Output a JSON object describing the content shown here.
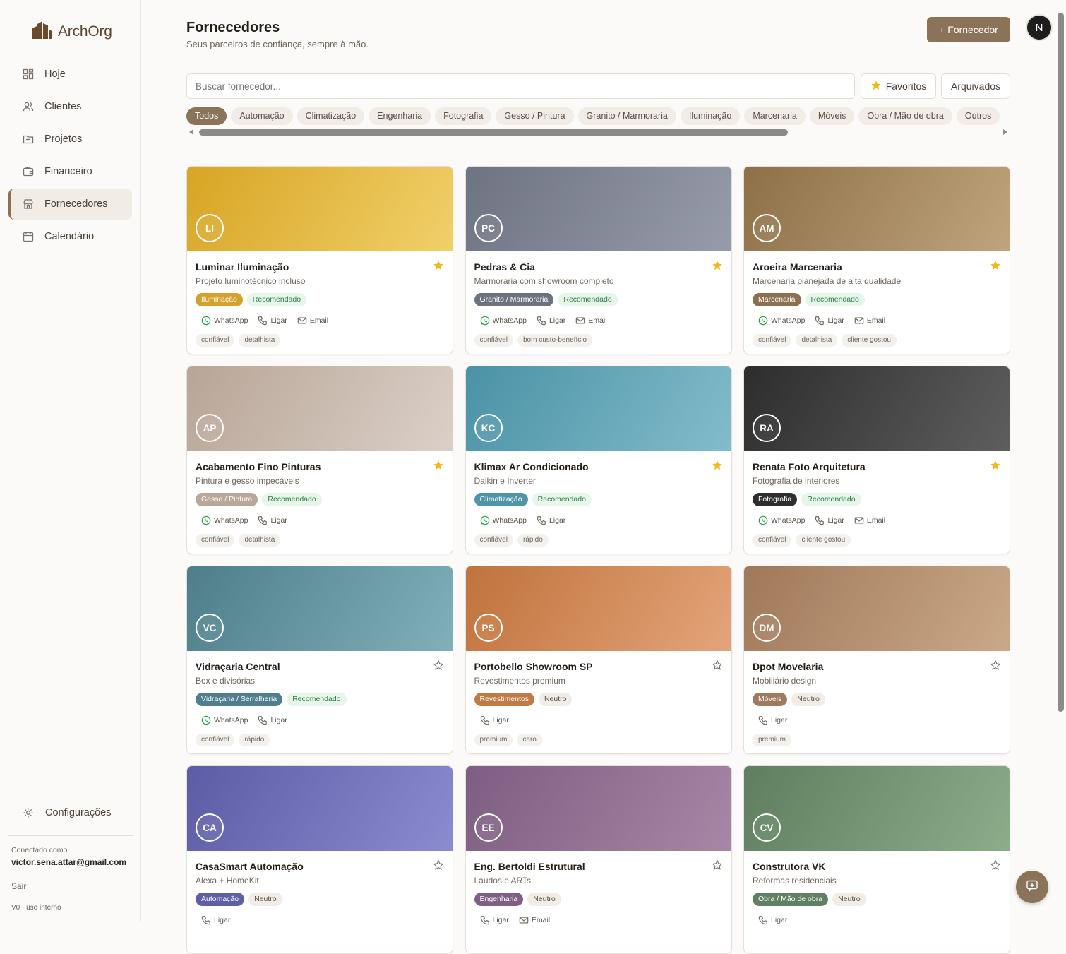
{
  "app": {
    "name": "ArchOrg"
  },
  "sidebar": {
    "items": [
      {
        "label": "Hoje",
        "icon": "dashboard-icon"
      },
      {
        "label": "Clientes",
        "icon": "users-icon"
      },
      {
        "label": "Projetos",
        "icon": "folder-icon"
      },
      {
        "label": "Financeiro",
        "icon": "wallet-icon"
      },
      {
        "label": "Fornecedores",
        "icon": "store-icon",
        "active": true
      },
      {
        "label": "Calendário",
        "icon": "calendar-icon"
      }
    ],
    "settings": "Configurações",
    "connected_as": "Conectado como",
    "email": "victor.sena.attar@gmail.com",
    "logout": "Sair",
    "version": "V0 · uso interno"
  },
  "header": {
    "title": "Fornecedores",
    "subtitle": "Seus parceiros de confiança, sempre à mão.",
    "add_button": "+ Fornecedor",
    "user_initial": "N"
  },
  "search": {
    "placeholder": "Buscar fornecedor..."
  },
  "filters": {
    "favorites": "Favoritos",
    "archived": "Arquivados"
  },
  "categories": [
    "Todos",
    "Automação",
    "Climatização",
    "Engenharia",
    "Fotografia",
    "Gesso / Pintura",
    "Granito / Marmoraria",
    "Iluminação",
    "Marcenaria",
    "Móveis",
    "Obra / Mão de obra",
    "Outros"
  ],
  "labels": {
    "whatsapp": "WhatsApp",
    "call": "Ligar",
    "email": "Email"
  },
  "suppliers": [
    {
      "initials": "LI",
      "name": "Luminar Iluminação",
      "desc": "Projeto luminotécnico incluso",
      "category": "Iluminação",
      "cat_color": "#d4a12a",
      "status": "Recomendado",
      "fav": true,
      "contacts": [
        "whatsapp",
        "call",
        "email"
      ],
      "notes": [
        "confiável",
        "detalhista"
      ],
      "grad": [
        "#d7a524",
        "#f1d06a"
      ]
    },
    {
      "initials": "PC",
      "name": "Pedras & Cia",
      "desc": "Marmoraria com showroom completo",
      "category": "Granito / Marmoraria",
      "cat_color": "#6c7280",
      "status": "Recomendado",
      "fav": true,
      "contacts": [
        "whatsapp",
        "call",
        "email"
      ],
      "notes": [
        "confiável",
        "bom custo-benefício"
      ],
      "grad": [
        "#6e7382",
        "#979caa"
      ]
    },
    {
      "initials": "AM",
      "name": "Aroeira Marcenaria",
      "desc": "Marcenaria planejada de alta qualidade",
      "category": "Marcenaria",
      "cat_color": "#8c7050",
      "status": "Recomendado",
      "fav": true,
      "contacts": [
        "whatsapp",
        "call",
        "email"
      ],
      "notes": [
        "confiável",
        "detalhista",
        "cliente gostou"
      ],
      "grad": [
        "#8d7048",
        "#c0a47c"
      ]
    },
    {
      "initials": "AP",
      "name": "Acabamento Fino Pinturas",
      "desc": "Pintura e gesso impecáveis",
      "category": "Gesso / Pintura",
      "cat_color": "#b9a899",
      "status": "Recomendado",
      "fav": true,
      "contacts": [
        "whatsapp",
        "call"
      ],
      "notes": [
        "confiável",
        "detalhista"
      ],
      "grad": [
        "#b8a596",
        "#dbd0c8"
      ]
    },
    {
      "initials": "KC",
      "name": "Klimax Ar Condicionado",
      "desc": "Daikin e Inverter",
      "category": "Climatização",
      "cat_color": "#4f95a8",
      "status": "Recomendado",
      "fav": true,
      "contacts": [
        "whatsapp",
        "call"
      ],
      "notes": [
        "confiável",
        "rápido"
      ],
      "grad": [
        "#4b92a6",
        "#82bccb"
      ]
    },
    {
      "initials": "RA",
      "name": "Renata Foto Arquitetura",
      "desc": "Fotografia de interiores",
      "category": "Fotografia",
      "cat_color": "#2e2e2e",
      "status": "Recomendado",
      "fav": true,
      "contacts": [
        "whatsapp",
        "call",
        "email"
      ],
      "notes": [
        "confiável",
        "cliente gostou"
      ],
      "grad": [
        "#2d2d2d",
        "#5e5e5e"
      ]
    },
    {
      "initials": "VC",
      "name": "Vidraçaria Central",
      "desc": "Box e divisórias",
      "category": "Vidraçaria / Serralheria",
      "cat_color": "#4f7f8c",
      "status": "Recomendado",
      "fav": false,
      "contacts": [
        "whatsapp",
        "call"
      ],
      "notes": [
        "confiável",
        "rápido"
      ],
      "grad": [
        "#4d7e8a",
        "#80b0ba"
      ]
    },
    {
      "initials": "PS",
      "name": "Portobello Showroom SP",
      "desc": "Revestimentos premium",
      "category": "Revestimentos",
      "cat_color": "#c07a45",
      "status": "Neutro",
      "fav": false,
      "contacts": [
        "call"
      ],
      "notes": [
        "premium",
        "caro"
      ],
      "grad": [
        "#c0733c",
        "#e4a47a"
      ]
    },
    {
      "initials": "DM",
      "name": "Dpot Movelaria",
      "desc": "Mobiliário design",
      "category": "Móveis",
      "cat_color": "#9f7a5e",
      "status": "Neutro",
      "fav": false,
      "contacts": [
        "call"
      ],
      "notes": [
        "premium"
      ],
      "grad": [
        "#a0785a",
        "#caa988"
      ]
    },
    {
      "initials": "CA",
      "name": "CasaSmart Automação",
      "desc": "Alexa + HomeKit",
      "category": "Automação",
      "cat_color": "#5f5fa8",
      "status": "Neutro",
      "fav": false,
      "contacts": [
        "call"
      ],
      "notes": [],
      "grad": [
        "#5c5ca6",
        "#8b8bd0"
      ]
    },
    {
      "initials": "EE",
      "name": "Eng. Bertoldi Estrutural",
      "desc": "Laudos e ARTs",
      "category": "Engenharia",
      "cat_color": "#7f5f84",
      "status": "Neutro",
      "fav": false,
      "contacts": [
        "call",
        "email"
      ],
      "notes": [],
      "grad": [
        "#7d5d82",
        "#a886a6"
      ]
    },
    {
      "initials": "CV",
      "name": "Construtora VK",
      "desc": "Reformas residenciais",
      "category": "Obra / Mão de obra",
      "cat_color": "#5f8062",
      "status": "Neutro",
      "fav": false,
      "contacts": [
        "call"
      ],
      "notes": [],
      "grad": [
        "#5e7e5f",
        "#8cac8a"
      ]
    }
  ]
}
